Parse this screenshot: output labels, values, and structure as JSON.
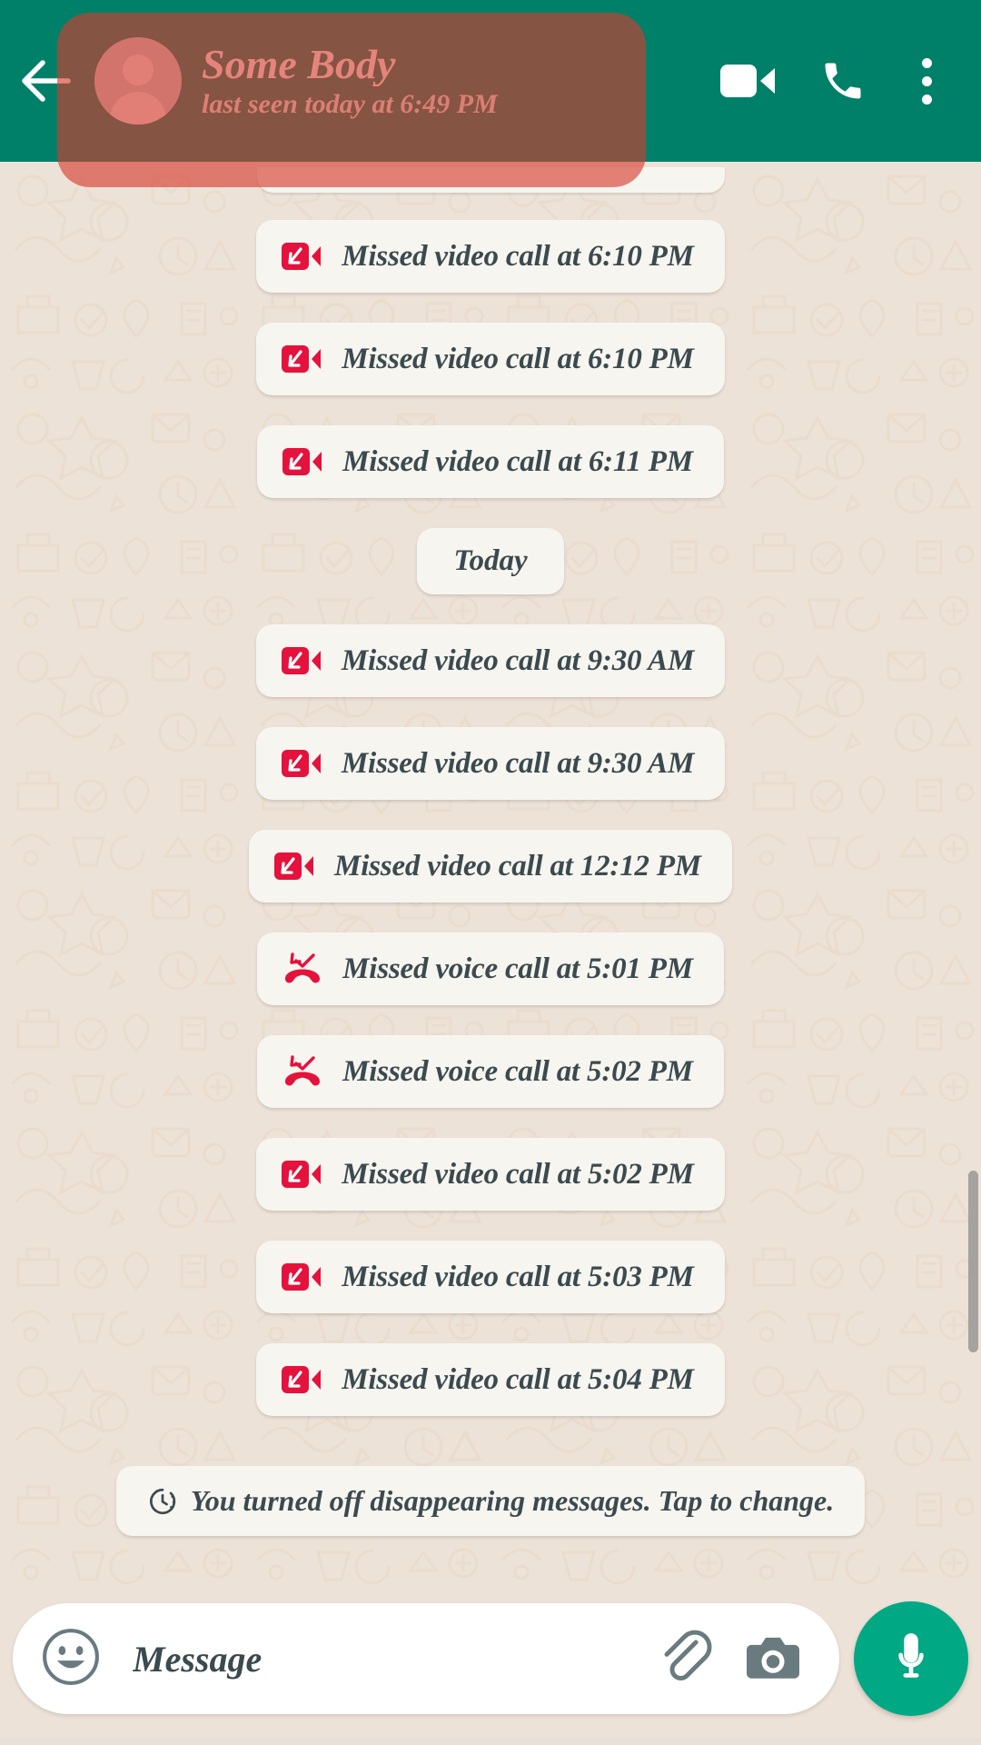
{
  "header": {
    "back_icon": "back-arrow-icon",
    "avatar_icon": "contact-avatar-icon",
    "contact_name": "Some Body",
    "status_text": "last seen today at 6:49 PM",
    "video_call_icon": "video-call-icon",
    "voice_call_icon": "voice-call-icon",
    "menu_icon": "overflow-menu-icon",
    "bg_color": "#008069",
    "highlight_overlay_color": "#D6392C"
  },
  "chat": {
    "background_color": "#EDE2D7",
    "bubble_color": "#F7F5F0",
    "text_color": "#3B4A4E",
    "missed_call_icon_color": "#E4123C",
    "messages": [
      {
        "kind": "partial",
        "icon": "",
        "text": ""
      },
      {
        "kind": "missed-video-call",
        "icon": "missed-video-call-icon",
        "text": "Missed video call at 6:10 PM"
      },
      {
        "kind": "missed-video-call",
        "icon": "missed-video-call-icon",
        "text": "Missed video call at 6:10 PM"
      },
      {
        "kind": "missed-video-call",
        "icon": "missed-video-call-icon",
        "text": "Missed video call at 6:11 PM"
      },
      {
        "kind": "date-divider",
        "icon": "",
        "text": "Today"
      },
      {
        "kind": "missed-video-call",
        "icon": "missed-video-call-icon",
        "text": "Missed video call at 9:30 AM"
      },
      {
        "kind": "missed-video-call",
        "icon": "missed-video-call-icon",
        "text": "Missed video call at 9:30 AM"
      },
      {
        "kind": "missed-video-call",
        "icon": "missed-video-call-icon",
        "text": "Missed video call at 12:12 PM"
      },
      {
        "kind": "missed-voice-call",
        "icon": "missed-voice-call-icon",
        "text": "Missed voice call at 5:01 PM"
      },
      {
        "kind": "missed-voice-call",
        "icon": "missed-voice-call-icon",
        "text": "Missed voice call at 5:02 PM"
      },
      {
        "kind": "missed-video-call",
        "icon": "missed-video-call-icon",
        "text": "Missed video call at 5:02 PM"
      },
      {
        "kind": "missed-video-call",
        "icon": "missed-video-call-icon",
        "text": "Missed video call at 5:03 PM"
      },
      {
        "kind": "missed-video-call",
        "icon": "missed-video-call-icon",
        "text": "Missed video call at 5:04 PM"
      }
    ],
    "system_notice": {
      "icon": "disappearing-messages-icon",
      "text": "You turned off disappearing messages. Tap to change."
    }
  },
  "composer": {
    "emoji_icon": "emoji-smiley-icon",
    "message_placeholder": "Message",
    "message_value": "",
    "attach_icon": "paperclip-icon",
    "camera_icon": "camera-icon",
    "mic_icon": "microphone-icon",
    "mic_button_color": "#00A884"
  }
}
